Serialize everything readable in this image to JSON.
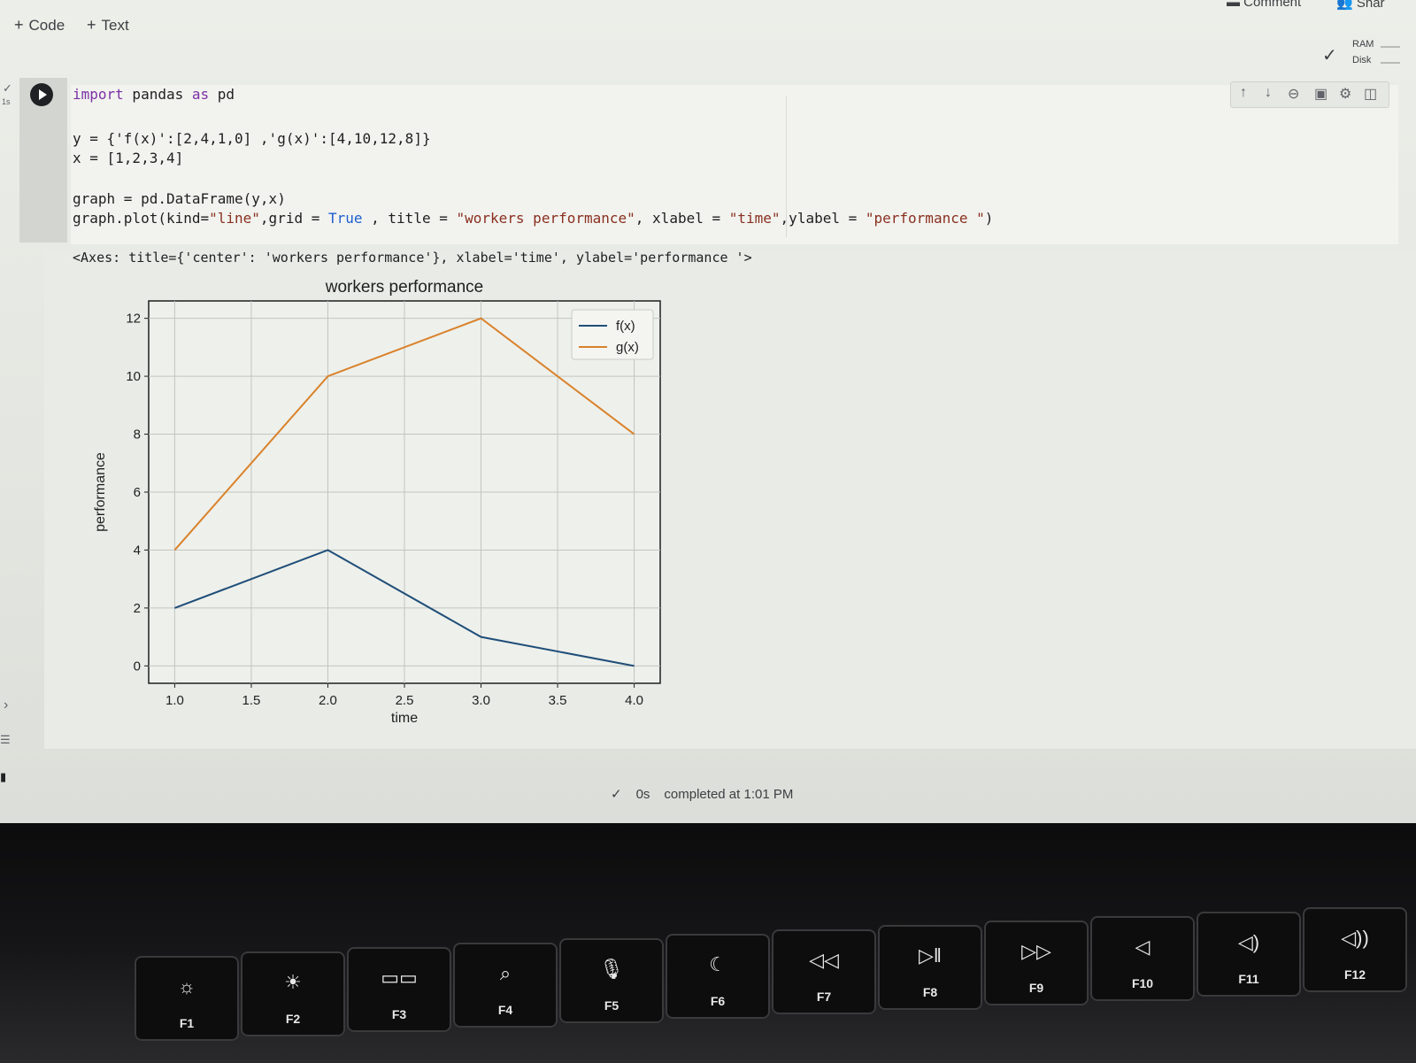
{
  "toolbar": {
    "add_code": "Code",
    "add_text": "Text",
    "comment": "Comment",
    "share": "Shar"
  },
  "resources": {
    "ram": "RAM",
    "disk": "Disk"
  },
  "cell": {
    "exec_time": "1s",
    "code_lines": [
      "import pandas as pd",
      "",
      "y = {'f(x)':[2,4,1,0] ,'g(x)':[4,10,12,8]}",
      "x = [1,2,3,4]",
      "",
      "graph = pd.DataFrame(y,x)",
      "graph.plot(kind=\"line\",grid = True , title = \"workers performance\", xlabel = \"time\",ylabel = \"performance \")"
    ],
    "output_text": "<Axes: title={'center': 'workers performance'}, xlabel='time', ylabel='performance '>"
  },
  "status": {
    "elapsed": "0s",
    "completed": "completed at 1:01 PM"
  },
  "chart_data": {
    "type": "line",
    "title": "workers performance",
    "xlabel": "time",
    "ylabel": "performance",
    "x": [
      1,
      2,
      3,
      4
    ],
    "series": [
      {
        "name": "f(x)",
        "values": [
          2,
          4,
          1,
          0
        ],
        "color": "#1f4e79"
      },
      {
        "name": "g(x)",
        "values": [
          4,
          10,
          12,
          8
        ],
        "color": "#d9822b"
      }
    ],
    "xticks": [
      "1.0",
      "1.5",
      "2.0",
      "2.5",
      "3.0",
      "3.5",
      "4.0"
    ],
    "yticks": [
      "0",
      "2",
      "4",
      "6",
      "8",
      "10",
      "12"
    ],
    "xlim": [
      0.83,
      4.17
    ],
    "ylim": [
      -0.6,
      12.6
    ],
    "grid": true,
    "legend": "top-right"
  },
  "keyboard": {
    "keys": [
      {
        "label": "F1",
        "icon": "☼"
      },
      {
        "label": "F2",
        "icon": "☀"
      },
      {
        "label": "F3",
        "icon": "▭▭"
      },
      {
        "label": "F4",
        "icon": "⌕"
      },
      {
        "label": "F5",
        "icon": "🎙"
      },
      {
        "label": "F6",
        "icon": "☾"
      },
      {
        "label": "F7",
        "icon": "◁◁"
      },
      {
        "label": "F8",
        "icon": "▷‖"
      },
      {
        "label": "F9",
        "icon": "▷▷"
      },
      {
        "label": "F10",
        "icon": "◁"
      },
      {
        "label": "F11",
        "icon": "◁)"
      },
      {
        "label": "F12",
        "icon": "◁))"
      }
    ]
  }
}
